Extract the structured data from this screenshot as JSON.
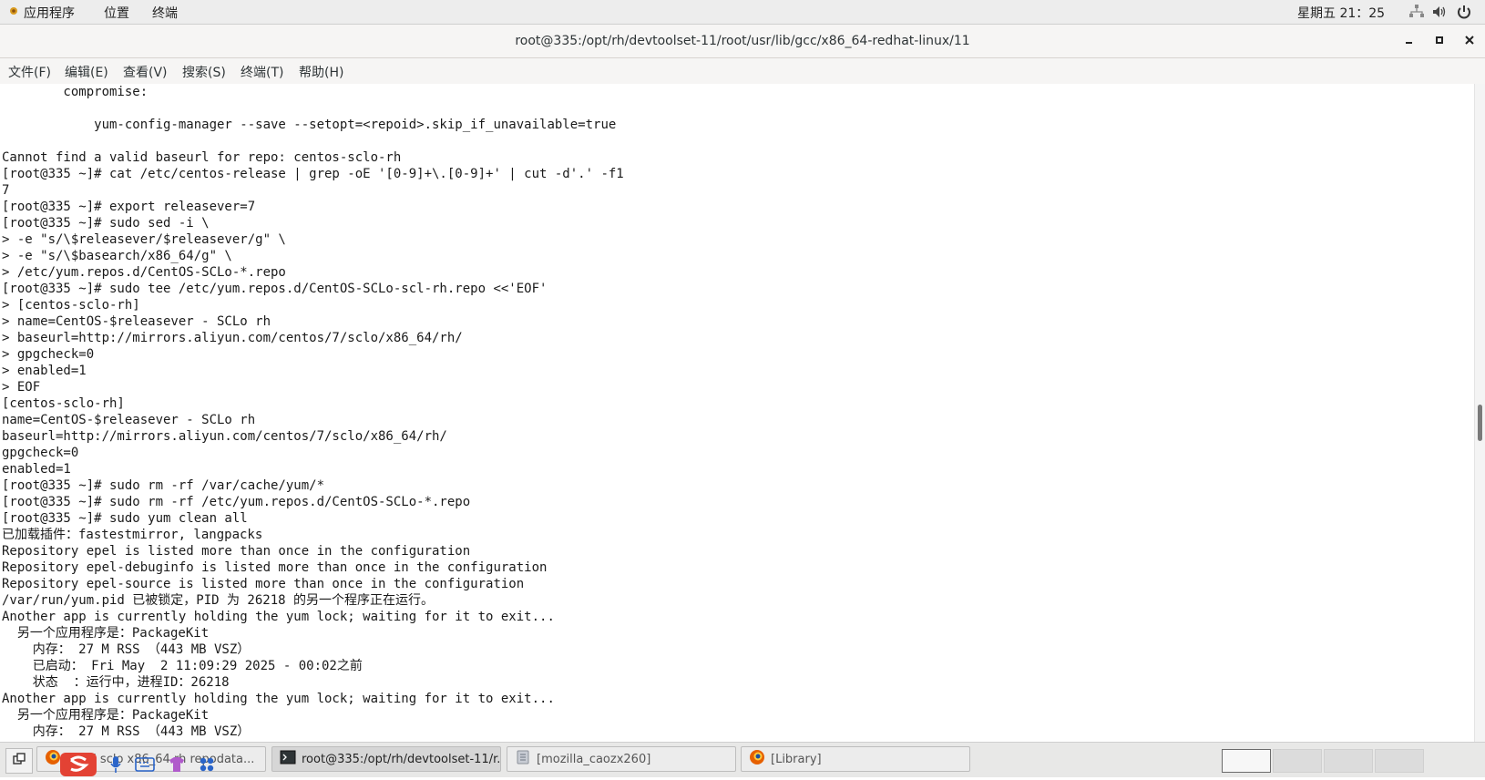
{
  "topbar": {
    "applications_label": "应用程序",
    "places_label": "位置",
    "terminal_label": "终端",
    "clock": "星期五 21：25"
  },
  "window": {
    "title": "root@335:/opt/rh/devtoolset-11/root/usr/lib/gcc/x86_64-redhat-linux/11"
  },
  "menubar": {
    "items": [
      "文件(F)",
      "编辑(E)",
      "查看(V)",
      "搜索(S)",
      "终端(T)",
      "帮助(H)"
    ]
  },
  "terminal": {
    "lines": [
      "        compromise:",
      "",
      "            yum-config-manager --save --setopt=<repoid>.skip_if_unavailable=true",
      "",
      "Cannot find a valid baseurl for repo: centos-sclo-rh",
      "[root@335 ~]# cat /etc/centos-release | grep -oE '[0-9]+\\.[0-9]+' | cut -d'.' -f1",
      "7",
      "[root@335 ~]# export releasever=7",
      "[root@335 ~]# sudo sed -i \\",
      "> -e \"s/\\$releasever/$releasever/g\" \\",
      "> -e \"s/\\$basearch/x86_64/g\" \\",
      "> /etc/yum.repos.d/CentOS-SCLo-*.repo",
      "[root@335 ~]# sudo tee /etc/yum.repos.d/CentOS-SCLo-scl-rh.repo <<'EOF'",
      "> [centos-sclo-rh]",
      "> name=CentOS-$releasever - SCLo rh",
      "> baseurl=http://mirrors.aliyun.com/centos/7/sclo/x86_64/rh/",
      "> gpgcheck=0",
      "> enabled=1",
      "> EOF",
      "[centos-sclo-rh]",
      "name=CentOS-$releasever - SCLo rh",
      "baseurl=http://mirrors.aliyun.com/centos/7/sclo/x86_64/rh/",
      "gpgcheck=0",
      "enabled=1",
      "[root@335 ~]# sudo rm -rf /var/cache/yum/*",
      "[root@335 ~]# sudo rm -rf /etc/yum.repos.d/CentOS-SCLo-*.repo",
      "[root@335 ~]# sudo yum clean all",
      "已加载插件：fastestmirror, langpacks",
      "Repository epel is listed more than once in the configuration",
      "Repository epel-debuginfo is listed more than once in the configuration",
      "Repository epel-source is listed more than once in the configuration",
      "/var/run/yum.pid 已被锁定，PID 为 26218 的另一个程序正在运行。",
      "Another app is currently holding the yum lock; waiting for it to exit...",
      "  另一个应用程序是：PackageKit",
      "    内存： 27 M RSS （443 MB VSZ）",
      "    已启动： Fri May  2 11:09:29 2025 - 00:02之前",
      "    状态  ：运行中，进程ID：26218",
      "Another app is currently holding the yum lock; waiting for it to exit...",
      "  另一个应用程序是：PackageKit",
      "    内存： 27 M RSS （443 MB VSZ）"
    ]
  },
  "taskbar": {
    "tasks": [
      {
        "label": "...e 7 sclo x86_64 rh repodata...",
        "icon": "firefox-icon"
      },
      {
        "label": "root@335:/opt/rh/devtoolset-11/r...",
        "icon": "terminal-icon"
      },
      {
        "label": "[mozilla_caozx260]",
        "icon": "file-manager-icon"
      },
      {
        "label": "[Library]",
        "icon": "firefox-icon"
      }
    ],
    "workspaces": 4,
    "active_workspace": 1
  },
  "colors": {
    "topbar_bg": "#ededed",
    "window_bg": "#f6f5f4",
    "terminal_bg": "#ffffff",
    "terminal_fg": "#1a1a1a",
    "accent_red": "#e34234"
  }
}
